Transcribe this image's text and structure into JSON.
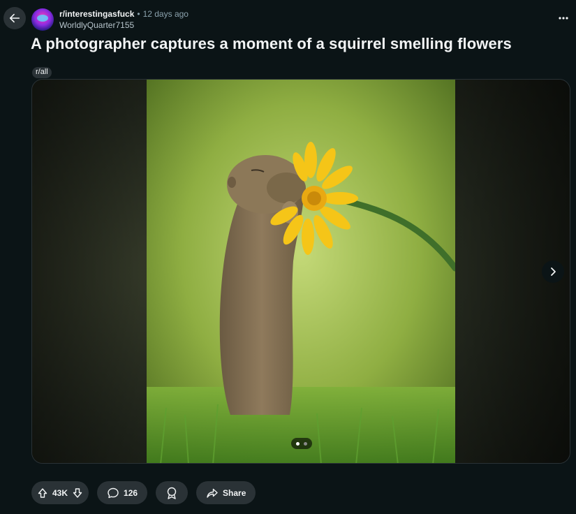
{
  "post": {
    "subreddit": "r/interestingasfuck",
    "separator": "•",
    "time_ago": "12 days ago",
    "author": "WorldlyQuarter7155",
    "title": "A photographer captures a moment of a squirrel smelling flowers",
    "flair": "r/all"
  },
  "media": {
    "image_count": 2,
    "current_index": 1,
    "subject": "squirrel smelling a yellow flower"
  },
  "actions": {
    "vote_count": "43K",
    "comment_count": "126",
    "share_label": "Share"
  },
  "icons": {
    "back": "arrow-left-icon",
    "more": "more-dots-icon",
    "next": "chevron-right-icon",
    "upvote": "upvote-arrow-icon",
    "downvote": "downvote-arrow-icon",
    "comment": "comment-bubble-icon",
    "award": "award-icon",
    "share": "share-arrow-icon"
  },
  "colors": {
    "background": "#0b1416",
    "pill": "#2a3236",
    "text": "#f2f4f5",
    "muted": "#8ba2ad"
  }
}
